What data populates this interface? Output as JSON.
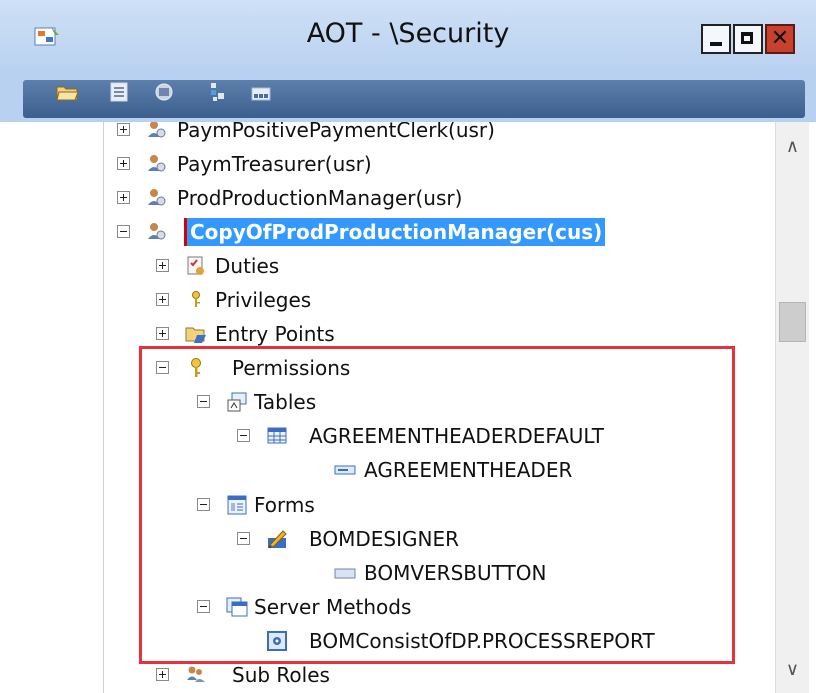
{
  "window": {
    "title": "AOT - \\Security",
    "close_symbol": "✕"
  },
  "toolbar": {
    "buttons": [
      "open-icon",
      "properties-icon",
      "compile-icon",
      "filter-icon",
      "layers-icon"
    ]
  },
  "tree": {
    "items": [
      {
        "label": "PaymPositivePaymentClerk(usr)",
        "state": "collapsed",
        "icon": "role-icon"
      },
      {
        "label": "PaymTreasurer(usr)",
        "state": "collapsed",
        "icon": "role-icon"
      },
      {
        "label": "ProdProductionManager(usr)",
        "state": "collapsed",
        "icon": "role-icon"
      },
      {
        "label": "CopyOfProdProductionManager(cus)",
        "state": "expanded",
        "icon": "role-icon",
        "selected": true
      },
      {
        "label": "Duties",
        "state": "collapsed",
        "icon": "duties-icon"
      },
      {
        "label": "Privileges",
        "state": "collapsed",
        "icon": "key-icon"
      },
      {
        "label": "Entry Points",
        "state": "collapsed",
        "icon": "entry-points-icon"
      },
      {
        "label": "Permissions",
        "state": "expanded",
        "icon": "key-icon"
      },
      {
        "label": "Tables",
        "state": "expanded",
        "icon": "tables-icon"
      },
      {
        "label": "AGREEMENTHEADERDEFAULT",
        "state": "expanded",
        "icon": "table-icon"
      },
      {
        "label": "AGREEMENTHEADER",
        "state": "leaf",
        "icon": "field-icon"
      },
      {
        "label": "Forms",
        "state": "expanded",
        "icon": "forms-icon"
      },
      {
        "label": "BOMDESIGNER",
        "state": "expanded",
        "icon": "form-design-icon"
      },
      {
        "label": "BOMVERSBUTTON",
        "state": "leaf",
        "icon": "control-icon"
      },
      {
        "label": "Server Methods",
        "state": "expanded",
        "icon": "server-methods-icon"
      },
      {
        "label": "BOMConsistOfDP.PROCESSREPORT",
        "state": "leaf",
        "icon": "method-icon"
      },
      {
        "label": "Sub Roles",
        "state": "collapsed",
        "icon": "sub-roles-icon"
      }
    ]
  },
  "colors": {
    "selection": "#3399ff",
    "highlight_box": "#e6323a",
    "titlebar": "#b9d1f0",
    "toolbar_strip": "#4a6d9c"
  }
}
